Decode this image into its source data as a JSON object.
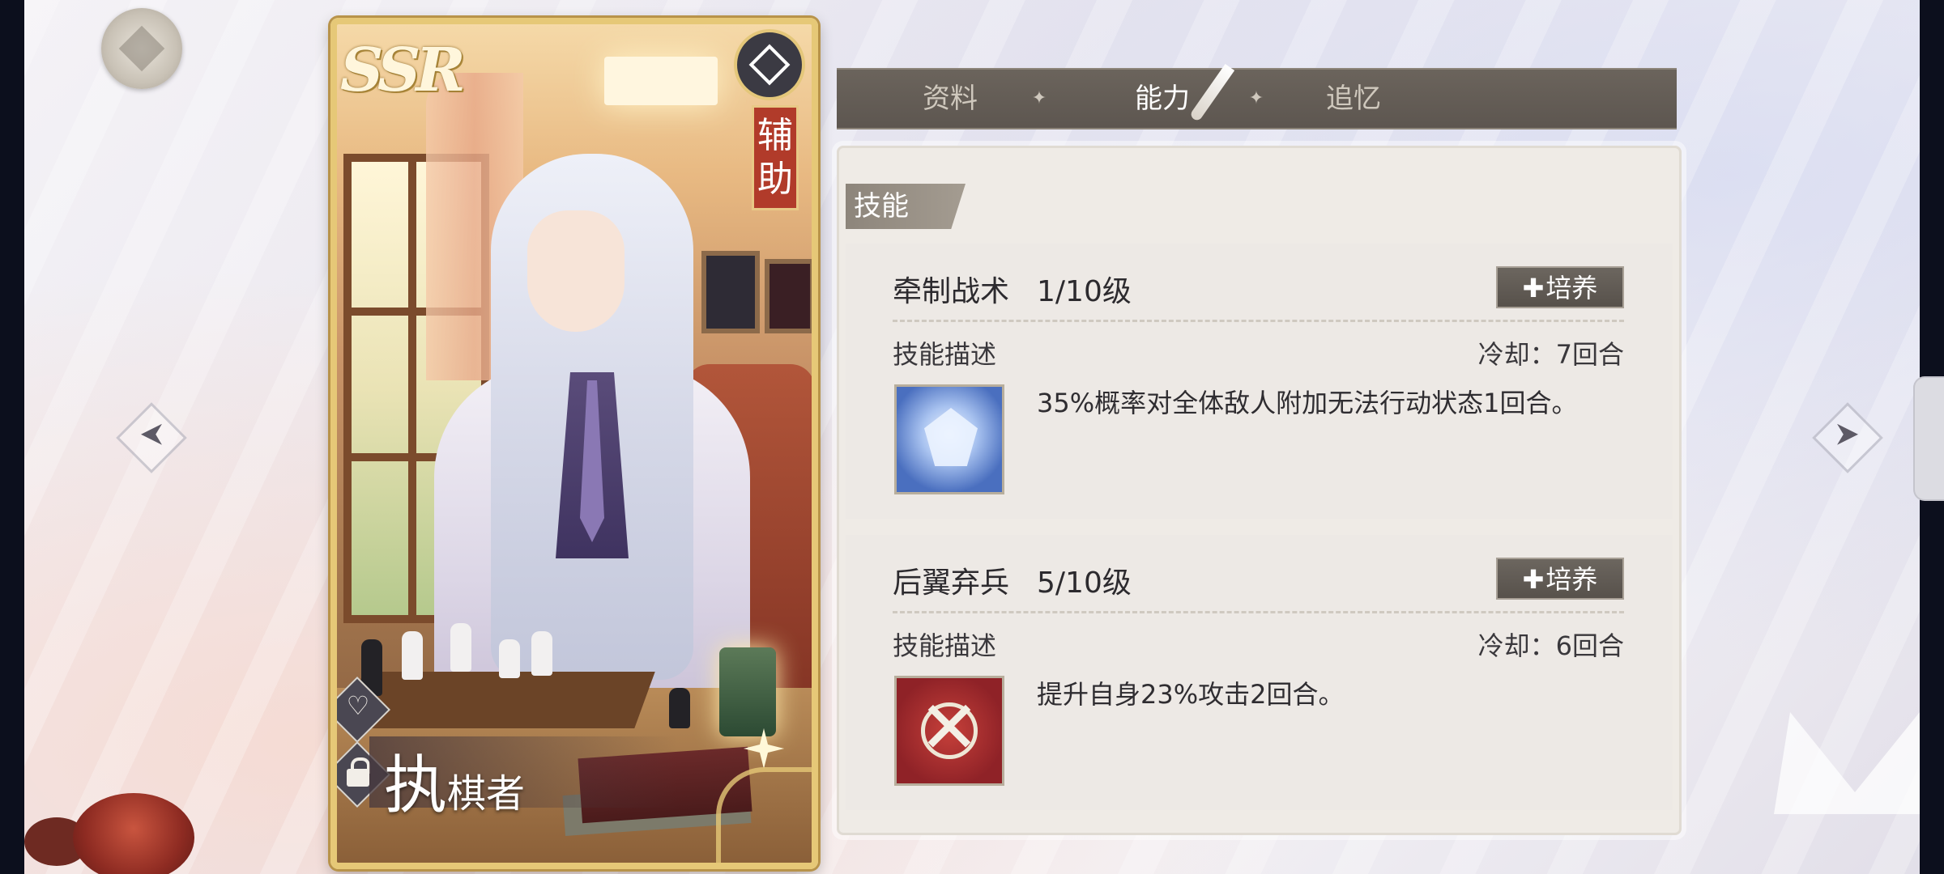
{
  "card": {
    "rarity": "SSR",
    "role": "辅助",
    "name_big": "执",
    "name_small": "棋者"
  },
  "tabs": [
    {
      "label": "资料",
      "active": false
    },
    {
      "label": "能力",
      "active": true
    },
    {
      "label": "追忆",
      "active": false
    }
  ],
  "section_title": "技能",
  "skills": [
    {
      "name": "牵制战术",
      "level": "1/10级",
      "train_label": "培养",
      "desc_label": "技能描述",
      "cooldown": "冷却：7回合",
      "description": "35%概率对全体敌人附加无法行动状态1回合。",
      "icon": "ice-crystal-icon"
    },
    {
      "name": "后翼弃兵",
      "level": "5/10级",
      "train_label": "培养",
      "desc_label": "技能描述",
      "cooldown": "冷却：6回合",
      "description": "提升自身23%攻击2回合。",
      "icon": "crossed-swords-icon"
    }
  ],
  "colors": {
    "tab_bar": "#5d5650",
    "panel_bg": "#efebe6",
    "role_tag": "#b13b2a",
    "card_border": "#e6c877"
  }
}
